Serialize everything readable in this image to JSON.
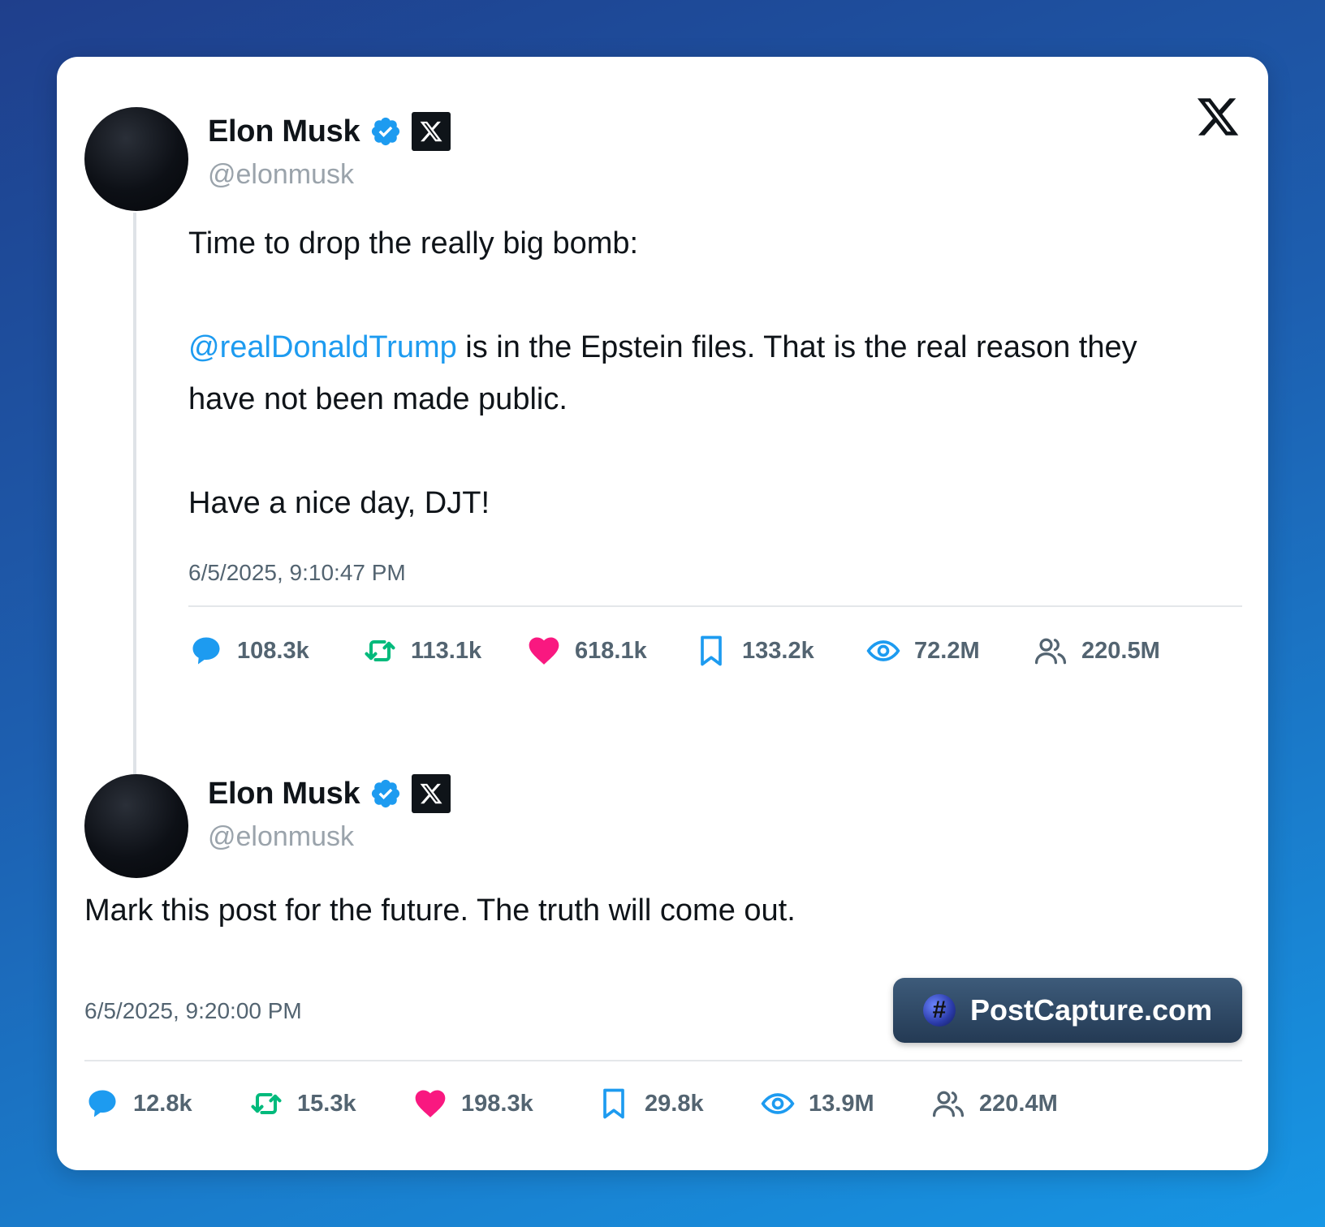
{
  "post1": {
    "author_name": "Elon Musk",
    "handle": "@elonmusk",
    "text_line1": "Time to drop the really big bomb:",
    "mention": "@realDonaldTrump",
    "text_line2": " is in the Epstein files. That is the real reason they",
    "text_line3": "have not been made public.",
    "text_line4": "Have a nice day, DJT!",
    "timestamp": "6/5/2025, 9:10:47 PM",
    "stats": {
      "replies": "108.3k",
      "reposts": "113.1k",
      "likes": "618.1k",
      "bookmarks": "133.2k",
      "views": "72.2M",
      "followers": "220.5M"
    }
  },
  "post2": {
    "author_name": "Elon Musk",
    "handle": "@elonmusk",
    "text": "Mark this post for the future. The truth will come out.",
    "timestamp": "6/5/2025, 9:20:00 PM",
    "stats": {
      "replies": "12.8k",
      "reposts": "15.3k",
      "likes": "198.3k",
      "bookmarks": "29.8k",
      "views": "13.9M",
      "followers": "220.4M"
    }
  },
  "watermark": {
    "label": "PostCapture.com",
    "icon": "hash-icon"
  },
  "icons": {
    "platform": "x-logo-icon",
    "verified": "verified-badge-icon",
    "reply": "comment-icon",
    "repost": "repost-icon",
    "like": "heart-icon",
    "bookmark": "bookmark-icon",
    "views": "eye-icon",
    "followers": "users-icon"
  },
  "colors": {
    "accent": "#1d9bf0",
    "repost": "#00ba7c",
    "like": "#f91880",
    "text": "#0f1419",
    "muted": "#536471"
  }
}
